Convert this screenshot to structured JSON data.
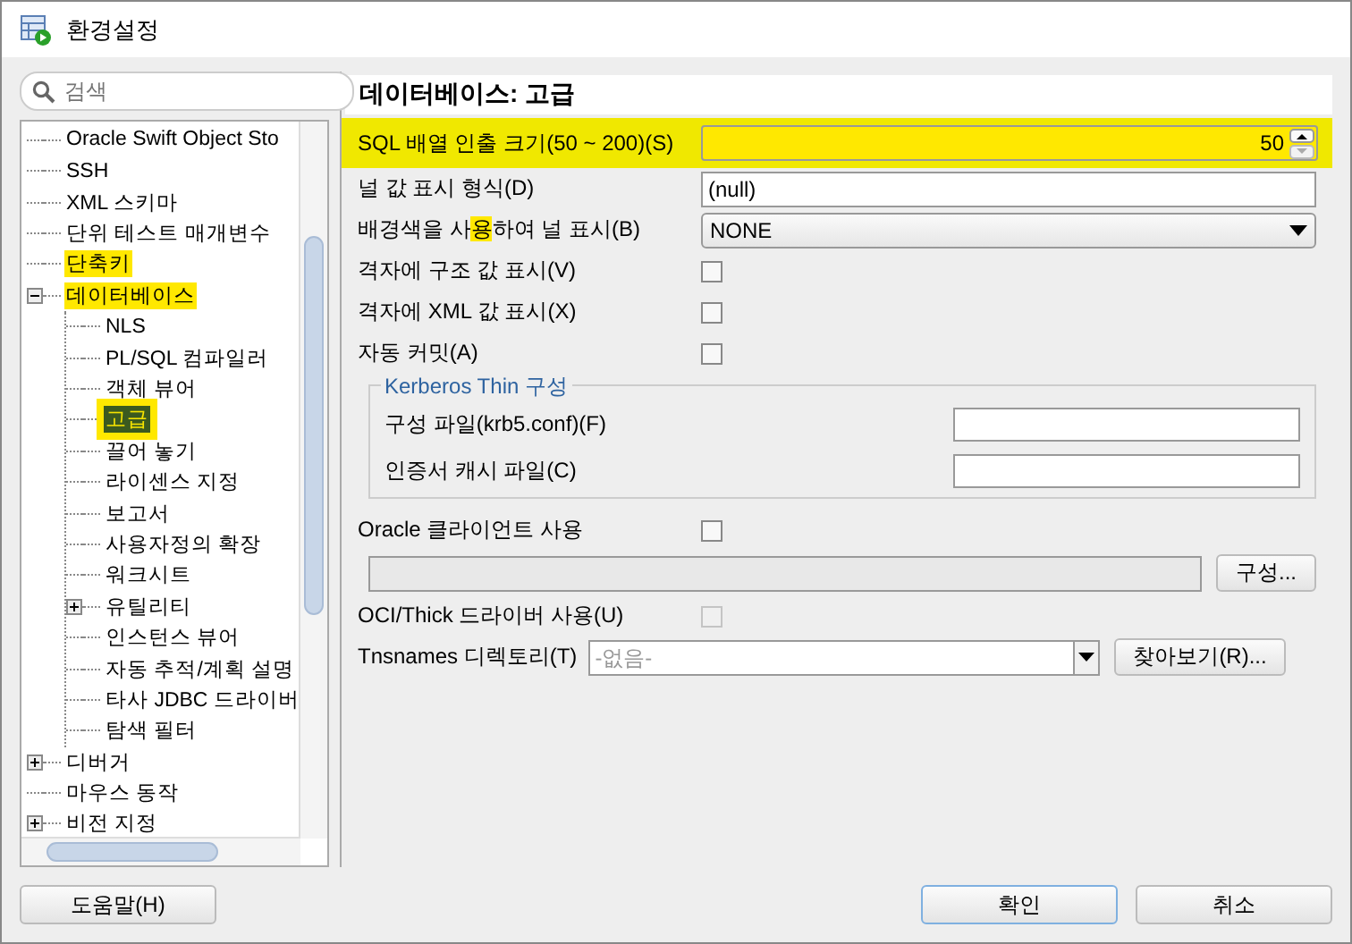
{
  "window": {
    "title": "환경설정"
  },
  "search": {
    "placeholder": "검색"
  },
  "tree": [
    {
      "label": "Oracle Swift Object Sto",
      "selected": false,
      "highlighted": false
    },
    {
      "label": "SSH",
      "selected": false,
      "highlighted": false
    },
    {
      "label": "XML 스키마",
      "selected": false,
      "highlighted": false
    },
    {
      "label": "단위 테스트 매개변수",
      "selected": false,
      "highlighted": false
    },
    {
      "label": "단축키",
      "selected": false,
      "highlighted": true
    },
    {
      "label": "데이터베이스",
      "selected": false,
      "highlighted": true,
      "expanded": true,
      "children": [
        {
          "label": "NLS",
          "selected": false,
          "highlighted": false
        },
        {
          "label": "PL/SQL 컴파일러",
          "selected": false,
          "highlighted": false
        },
        {
          "label": "객체 뷰어",
          "selected": false,
          "highlighted": false
        },
        {
          "label": "고급",
          "selected": true,
          "highlighted": true
        },
        {
          "label": "끌어 놓기",
          "selected": false,
          "highlighted": false
        },
        {
          "label": "라이센스 지정",
          "selected": false,
          "highlighted": false
        },
        {
          "label": "보고서",
          "selected": false,
          "highlighted": false
        },
        {
          "label": "사용자정의 확장",
          "selected": false,
          "highlighted": false
        },
        {
          "label": "워크시트",
          "selected": false,
          "highlighted": false
        },
        {
          "label": "유틸리티",
          "selected": false,
          "highlighted": false,
          "expanded": false
        },
        {
          "label": "인스턴스 뷰어",
          "selected": false,
          "highlighted": false
        },
        {
          "label": "자동 추적/계획 설명",
          "selected": false,
          "highlighted": false
        },
        {
          "label": "타사 JDBC 드라이버",
          "selected": false,
          "highlighted": false
        },
        {
          "label": "탐색 필터",
          "selected": false,
          "highlighted": false
        }
      ]
    },
    {
      "label": "디버거",
      "selected": false,
      "highlighted": false,
      "expanded": false
    },
    {
      "label": "마우스 동작",
      "selected": false,
      "highlighted": false
    },
    {
      "label": "비전 지정",
      "selected": false,
      "highlighted": false,
      "expanded": false
    }
  ],
  "panel": {
    "title": "데이터베이스: 고급"
  },
  "settings": [
    {
      "kind": "spinner",
      "label": "SQL 배열 인출 크기(50 ~ 200)(S)",
      "value": "50",
      "highlighted": true
    },
    {
      "kind": "text",
      "label": "널 값 표시 형식(D)",
      "value": "(null)",
      "highlighted": false
    },
    {
      "kind": "dropdown",
      "label_parts": [
        {
          "text": "배경색을 사",
          "highlighted": false
        },
        {
          "text": "용",
          "highlighted": true
        },
        {
          "text": "하여 널 표시(B)",
          "highlighted": false
        }
      ],
      "value": "NONE"
    },
    {
      "kind": "checkbox",
      "label": "격자에 구조 값 표시(V)",
      "checked": false,
      "disabled": false,
      "highlighted": false
    },
    {
      "kind": "checkbox",
      "label": "격자에 XML 값 표시(X)",
      "checked": false,
      "disabled": false,
      "highlighted": false
    },
    {
      "kind": "checkbox",
      "label": "자동 커밋(A)",
      "checked": false,
      "disabled": false,
      "highlighted": false
    },
    {
      "kind": "group",
      "title": "Kerberos Thin 구성",
      "fields": [
        {
          "label": "구성 파일(krb5.conf)(F)"
        },
        {
          "label": "인증서 캐시 파일(C)"
        }
      ]
    },
    {
      "kind": "checkbox",
      "label": "Oracle 클라이언트 사용",
      "checked": false,
      "disabled": false,
      "highlighted": false
    },
    {
      "kind": "path",
      "button": "구성...",
      "disabled": true
    },
    {
      "kind": "checkbox",
      "label": "OCI/Thick 드라이버 사용(U)",
      "checked": false,
      "disabled": true,
      "highlighted": false
    },
    {
      "kind": "combo",
      "label": "Tnsnames 디렉토리(T)",
      "placeholder": "-없음-",
      "button": "찾아보기(R)..."
    }
  ],
  "buttons": {
    "help": "도움말(H)",
    "ok": "확인",
    "cancel": "취소"
  }
}
